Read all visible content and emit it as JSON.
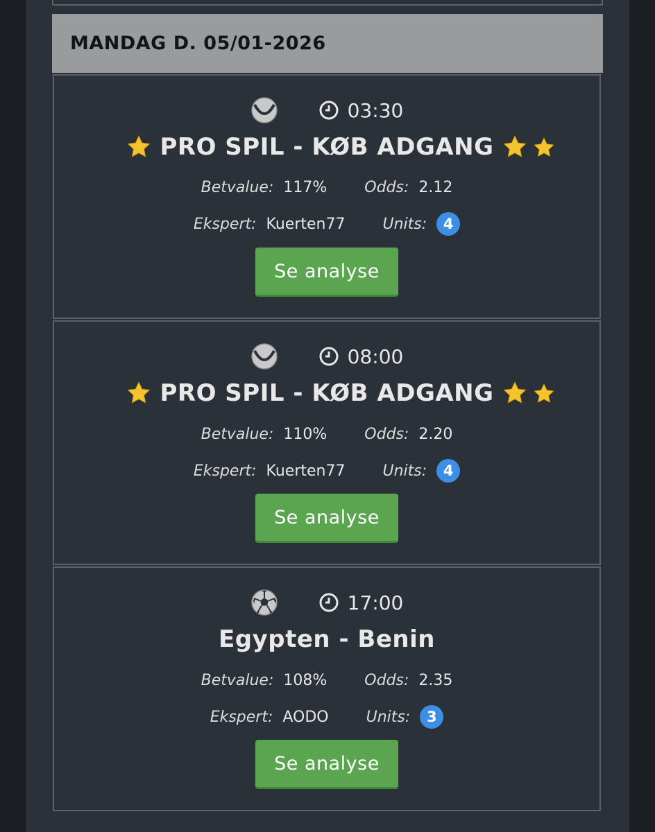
{
  "date_header": "MANDAG D. 05/01-2026",
  "tips": [
    {
      "sport_icon": "tennis-ball-icon",
      "time": "03:30",
      "title": "PRO SPIL - KØB ADGANG",
      "pro": true,
      "betvalue_label": "Betvalue:",
      "betvalue": "117%",
      "odds_label": "Odds:",
      "odds": "2.12",
      "ekspert_label": "Ekspert:",
      "ekspert": "Kuerten77",
      "units_label": "Units:",
      "units": "4",
      "button": "Se analyse"
    },
    {
      "sport_icon": "tennis-ball-icon",
      "time": "08:00",
      "title": "PRO SPIL - KØB ADGANG",
      "pro": true,
      "betvalue_label": "Betvalue:",
      "betvalue": "110%",
      "odds_label": "Odds:",
      "odds": "2.20",
      "ekspert_label": "Ekspert:",
      "ekspert": "Kuerten77",
      "units_label": "Units:",
      "units": "4",
      "button": "Se analyse"
    },
    {
      "sport_icon": "soccer-ball-icon",
      "time": "17:00",
      "title": "Egypten - Benin",
      "pro": false,
      "betvalue_label": "Betvalue:",
      "betvalue": "108%",
      "odds_label": "Odds:",
      "odds": "2.35",
      "ekspert_label": "Ekspert:",
      "ekspert": "AODO",
      "units_label": "Units:",
      "units": "3",
      "button": "Se analyse"
    }
  ],
  "colors": {
    "background": "#2b3138",
    "header": "#9a9b9d",
    "button": "#5ba551",
    "badge": "#3d8fe6",
    "star": "#f4c430"
  }
}
